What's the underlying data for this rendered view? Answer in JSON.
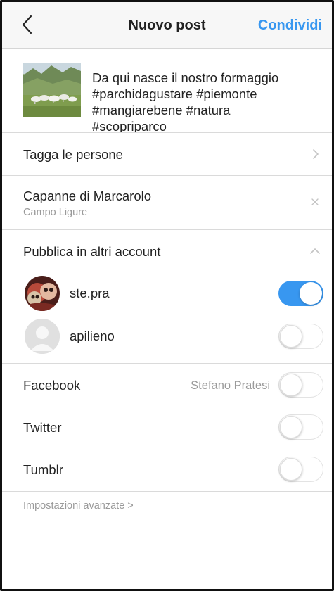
{
  "header": {
    "title": "Nuovo post",
    "share_label": "Condividi"
  },
  "post": {
    "caption": "Da qui nasce il nostro formaggio\n#parchidagustare #piemonte\n#mangiarebene #natura\n#scopriparco"
  },
  "tag_people": {
    "label": "Tagga le persone"
  },
  "location": {
    "name": "Capanne di Marcarolo",
    "subtitle": "Campo Ligure"
  },
  "other_accounts": {
    "label": "Pubblica in altri account",
    "accounts": [
      {
        "name": "ste.pra",
        "enabled": true
      },
      {
        "name": "apilieno",
        "enabled": false
      }
    ]
  },
  "share_to": [
    {
      "name": "Facebook",
      "user": "Stefano Pratesi",
      "enabled": false
    },
    {
      "name": "Twitter",
      "enabled": false
    },
    {
      "name": "Tumblr",
      "enabled": false
    }
  ],
  "advanced": {
    "label": "Impostazioni avanzate >"
  },
  "colors": {
    "accent": "#3897f0",
    "muted": "#9a9a9a",
    "divider": "#dadada"
  }
}
